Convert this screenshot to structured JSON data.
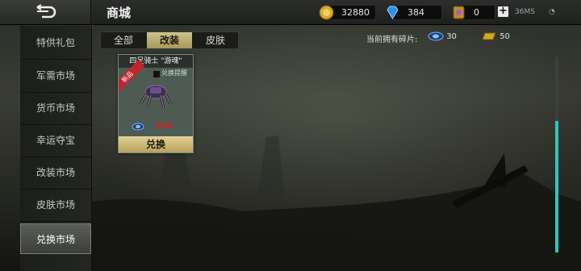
{
  "header": {
    "title": "商城",
    "currencies": [
      {
        "name": "gold-coin",
        "value": "32880",
        "color": "#d4a82a"
      },
      {
        "name": "diamond",
        "value": "384",
        "color": "#2a8ff0"
      },
      {
        "name": "ticket",
        "value": "0",
        "color": "#b070d0"
      }
    ],
    "network": "36MS"
  },
  "sidebar": {
    "items": [
      {
        "label": "特供礼包",
        "active": false
      },
      {
        "label": "军需市场",
        "active": false
      },
      {
        "label": "货币市场",
        "active": false
      },
      {
        "label": "幸运夺宝",
        "active": false
      },
      {
        "label": "改装市场",
        "active": false
      },
      {
        "label": "皮肤市场",
        "active": false
      },
      {
        "label": "兑换市场",
        "active": true
      }
    ]
  },
  "tabs": [
    {
      "label": "全部",
      "active": false
    },
    {
      "label": "改装",
      "active": true
    },
    {
      "label": "皮肤",
      "active": false
    }
  ],
  "shards": {
    "label": "当前拥有碎片:",
    "blue_count": "30",
    "gold_count": "50"
  },
  "card": {
    "title": "四足骑士 \"游魂\"",
    "badge": "新品",
    "checkbox_label": "兑换提醒",
    "price": "600",
    "button_label": "兑换"
  }
}
